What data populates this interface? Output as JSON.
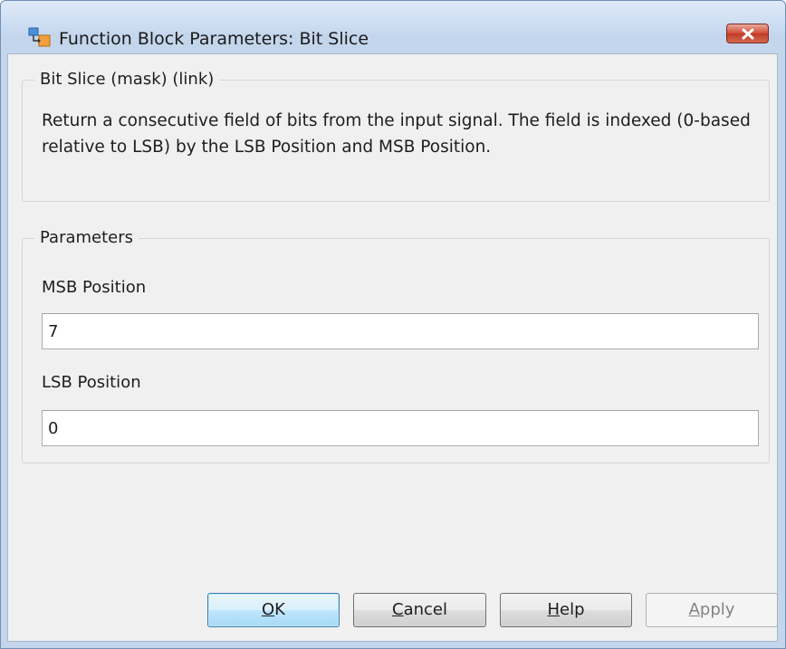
{
  "window": {
    "title": "Function Block Parameters: Bit Slice",
    "app_icon": "simulink-block-icon",
    "close_icon": "close-icon"
  },
  "block_group": {
    "legend": "Bit Slice (mask) (link)",
    "description": "Return a consecutive field of bits from the input signal. The field is indexed (0-based relative to LSB) by the LSB Position and MSB Position."
  },
  "parameters_group": {
    "legend": "Parameters",
    "msb": {
      "label": "MSB Position",
      "value": "7"
    },
    "lsb": {
      "label": "LSB Position",
      "value": "0"
    }
  },
  "buttons": {
    "ok": {
      "label": "OK",
      "mnemonic": "O",
      "rest": "K"
    },
    "cancel": {
      "label": "Cancel",
      "mnemonic": "C",
      "rest": "ancel"
    },
    "help": {
      "label": "Help",
      "mnemonic": "H",
      "rest": "elp"
    },
    "apply": {
      "label": "Apply",
      "mnemonic": "A",
      "rest": "pply",
      "enabled": false
    }
  },
  "colors": {
    "title_bar": "#c6d8ef",
    "dialog_background": "#f0f0f0",
    "close_button": "#c13a24",
    "default_button_border": "#3c7fb1",
    "disabled_text": "#838383"
  }
}
